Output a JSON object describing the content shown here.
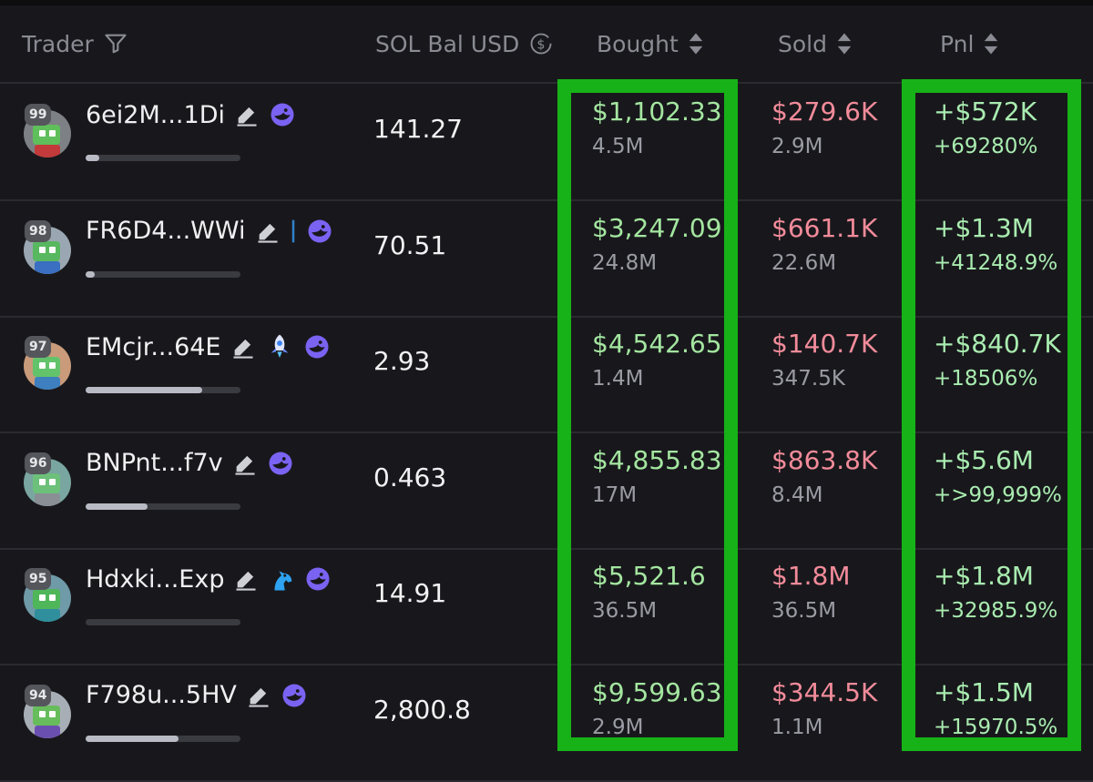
{
  "header": {
    "trader": "Trader",
    "sol_bal": "SOL Bal USD",
    "bought": "Bought",
    "sold": "Sold",
    "pnl": "Pnl"
  },
  "colors": {
    "background": "#18181c",
    "bought_green": "#a4e6a0",
    "sold_red": "#f28b9a",
    "highlight_green": "#17b217"
  },
  "rows": [
    {
      "rank": "99",
      "address": "6ei2M...1Di",
      "sol": "141.27",
      "bought": "$1,102.33",
      "bought_sub": "4.5M",
      "sold": "$279.6K",
      "sold_sub": "2.9M",
      "pnl": "+$572K",
      "pnl_pct": "+69280%",
      "progress": 0.09,
      "icons": [
        "edit-icon",
        "whale-icon"
      ]
    },
    {
      "rank": "98",
      "address": "FR6D4...WWi",
      "sol": "70.51",
      "bought": "$3,247.09",
      "bought_sub": "24.8M",
      "sold": "$661.1K",
      "sold_sub": "22.6M",
      "pnl": "+$1.3M",
      "pnl_pct": "+41248.9%",
      "progress": 0.03,
      "icons": [
        "edit-icon",
        "divider-icon",
        "whale-icon"
      ]
    },
    {
      "rank": "97",
      "address": "EMcjr...64E",
      "sol": "2.93",
      "bought": "$4,542.65",
      "bought_sub": "1.4M",
      "sold": "$140.7K",
      "sold_sub": "347.5K",
      "pnl": "+$840.7K",
      "pnl_pct": "+18506%",
      "progress": 0.75,
      "icons": [
        "edit-icon",
        "rocket-icon",
        "whale-icon"
      ]
    },
    {
      "rank": "96",
      "address": "BNPnt...f7v",
      "sol": "0.463",
      "bought": "$4,855.83",
      "bought_sub": "17M",
      "sold": "$863.8K",
      "sold_sub": "8.4M",
      "pnl": "+$5.6M",
      "pnl_pct": "+>99,999%",
      "progress": 0.4,
      "icons": [
        "edit-icon",
        "whale-icon"
      ]
    },
    {
      "rank": "95",
      "address": "Hdxki...Exp",
      "sol": "14.91",
      "bought": "$5,521.6",
      "bought_sub": "36.5M",
      "sold": "$1.8M",
      "sold_sub": "36.5M",
      "pnl": "+$1.8M",
      "pnl_pct": "+32985.9%",
      "progress": 0.0,
      "icons": [
        "edit-icon",
        "horse-icon",
        "whale-icon"
      ]
    },
    {
      "rank": "94",
      "address": "F798u...5HV",
      "sol": "2,800.8",
      "bought": "$9,599.63",
      "bought_sub": "2.9M",
      "sold": "$344.5K",
      "sold_sub": "1.1M",
      "pnl": "+$1.5M",
      "pnl_pct": "+15970.5%",
      "progress": 0.6,
      "icons": [
        "edit-icon",
        "whale-icon"
      ]
    }
  ]
}
